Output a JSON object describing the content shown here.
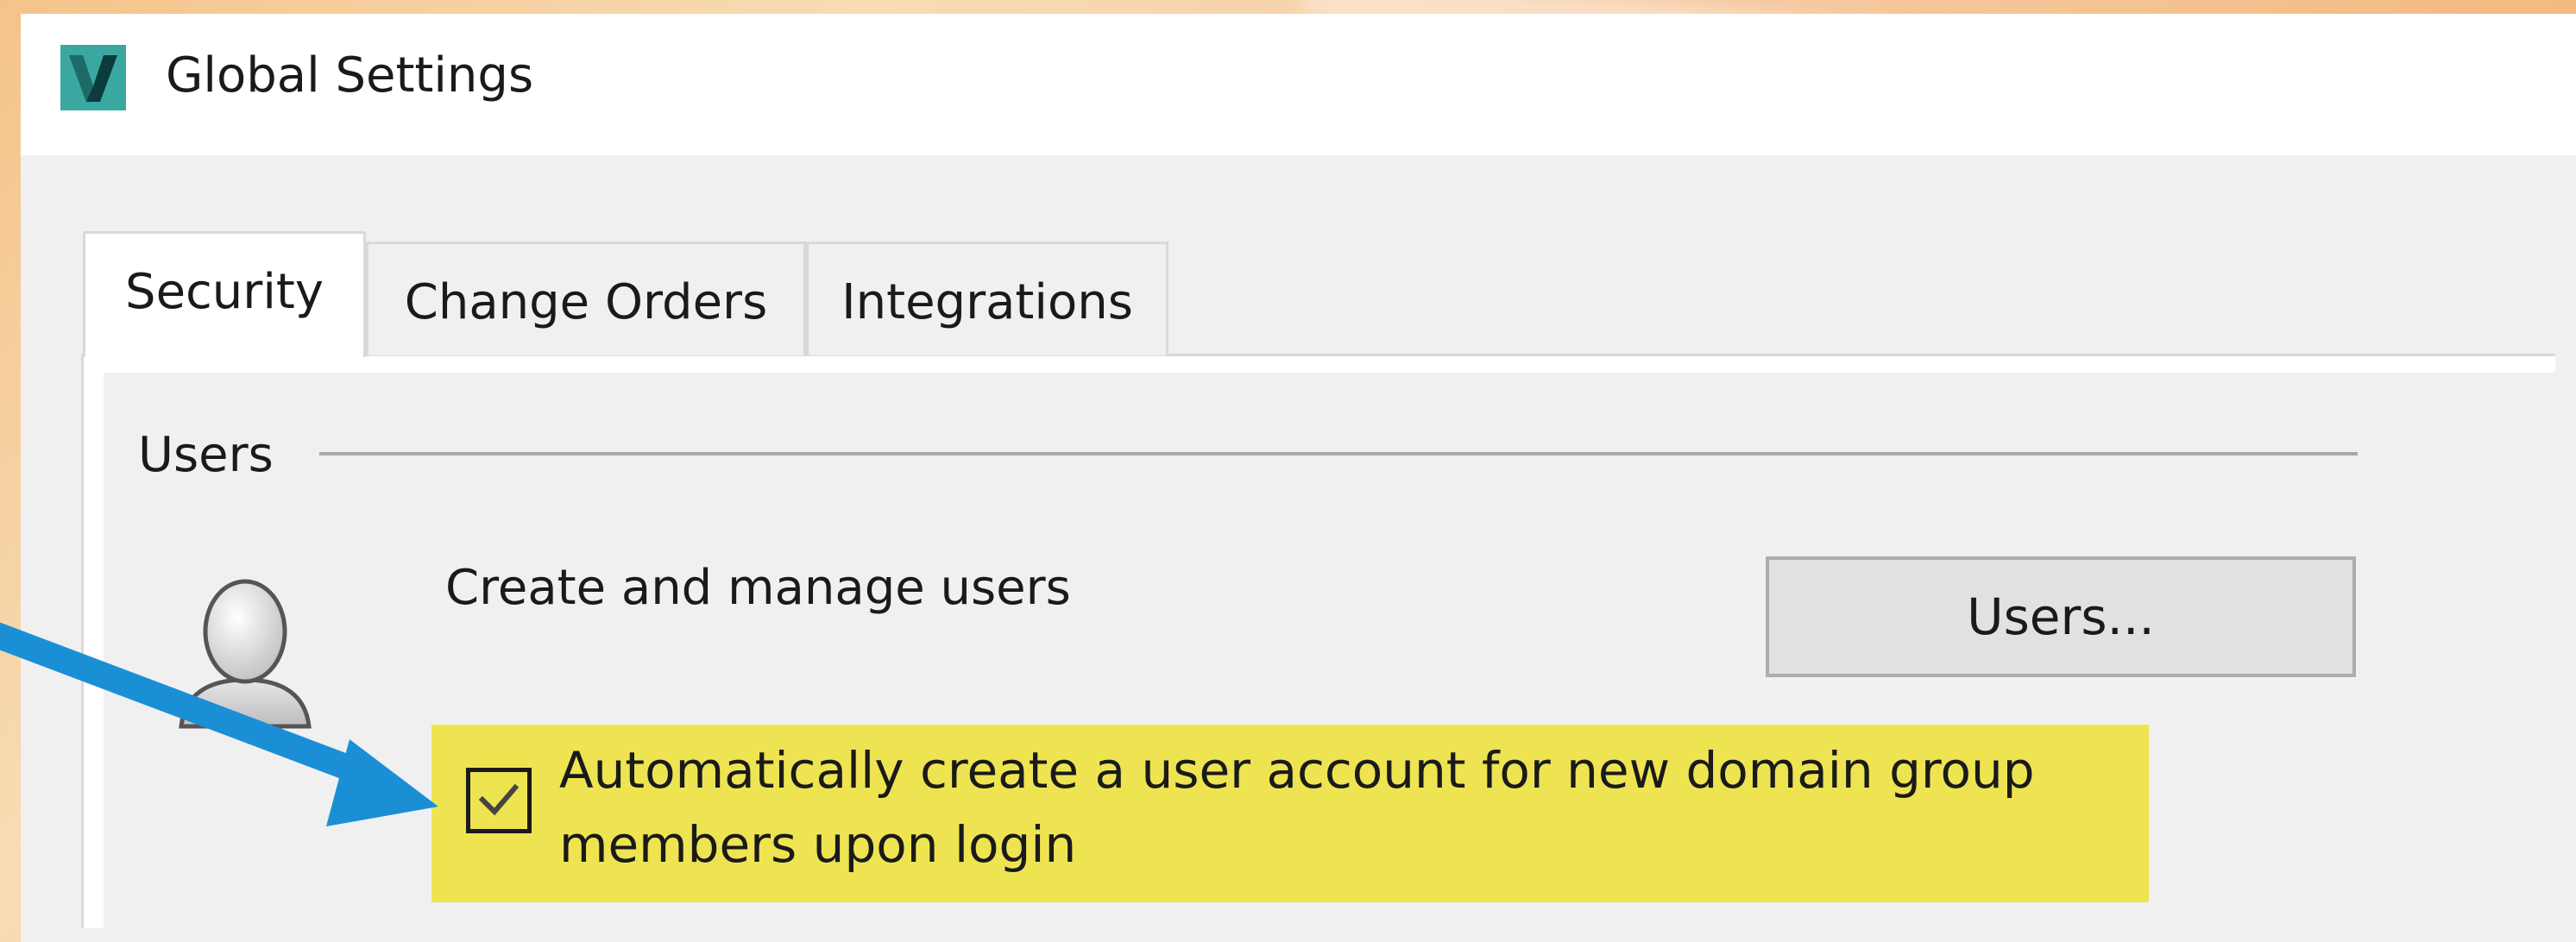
{
  "window": {
    "title": "Global Settings",
    "icon": "app-v-icon",
    "accent": "#2a9a9a"
  },
  "tabs": [
    {
      "label": "Security",
      "active": true
    },
    {
      "label": "Change Orders",
      "active": false
    },
    {
      "label": "Integrations",
      "active": false
    }
  ],
  "users_group": {
    "label": "Users",
    "icon": "user-icon",
    "description": "Create and manage users",
    "button_label": "Users...",
    "auto_create": {
      "checked": true,
      "label": "Automatically create a user account for new domain group members upon login"
    }
  },
  "annotation": {
    "highlight_color": "#eee452",
    "arrow_color": "#1b8fd6"
  }
}
